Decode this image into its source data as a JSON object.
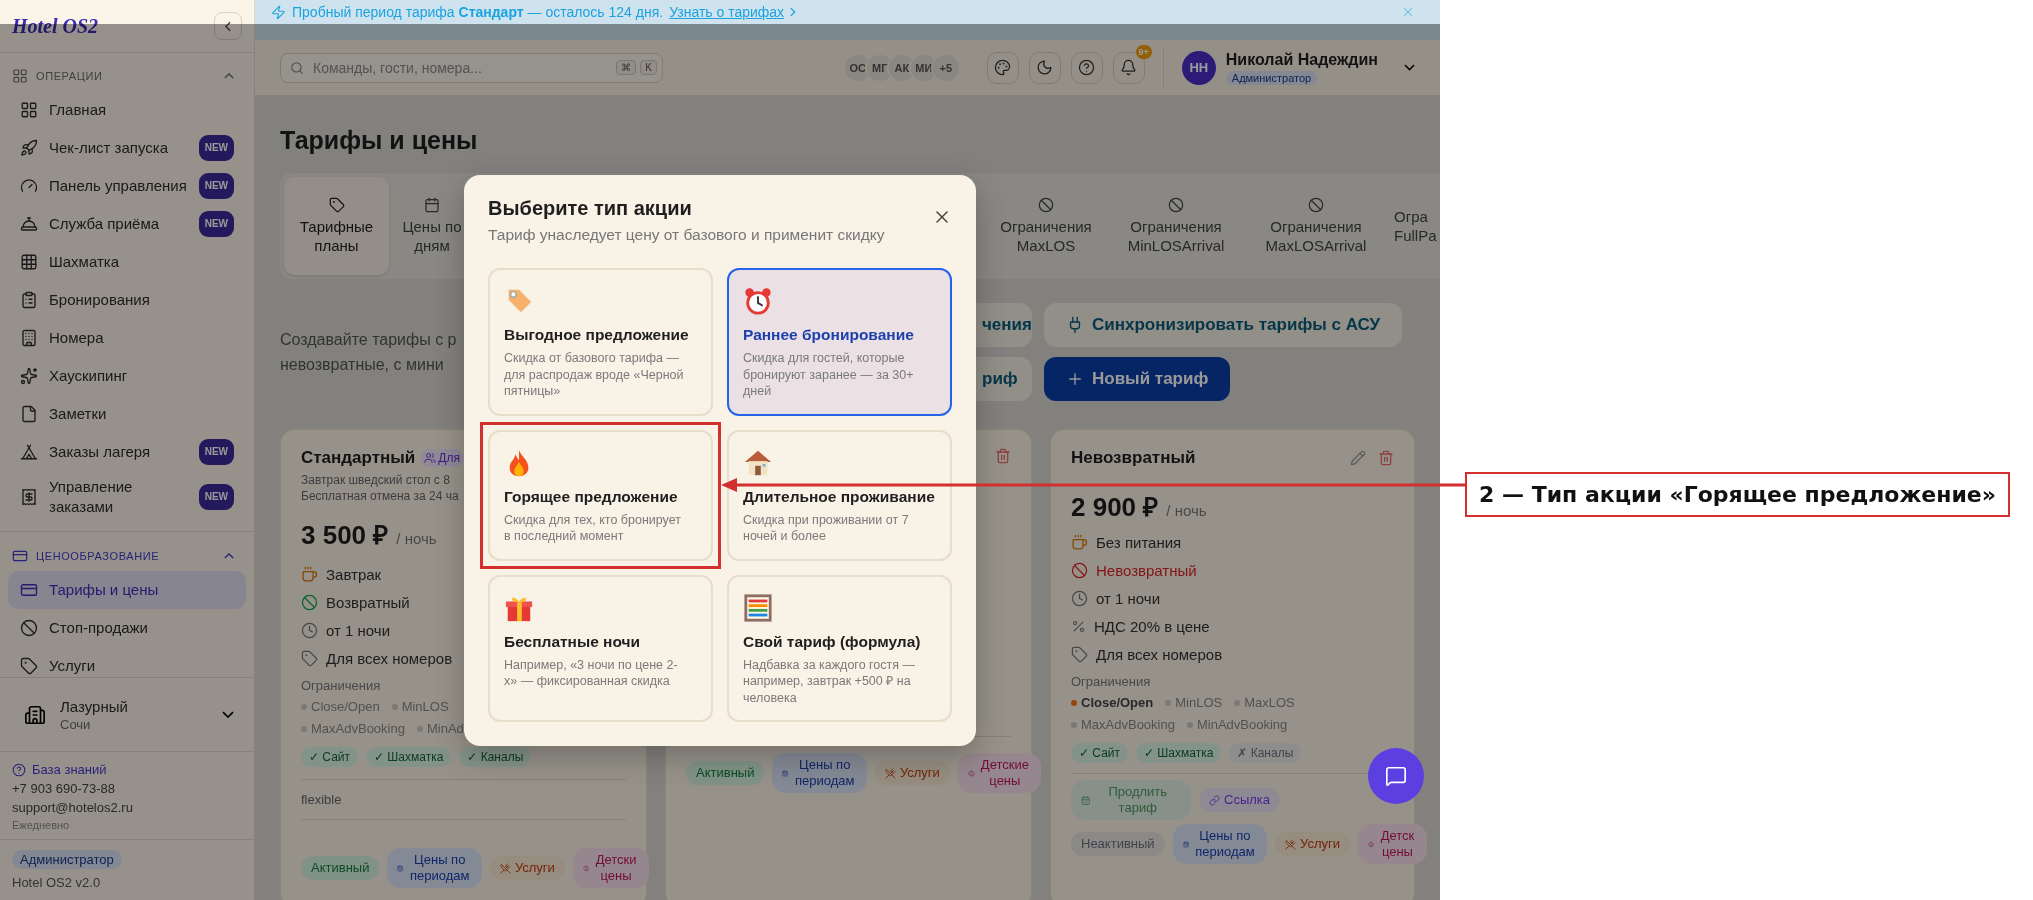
{
  "banner": {
    "text": "Пробный период тарифа **Стандарт** — осталось 124 дня.",
    "link": "Узнать о тарифах"
  },
  "sidebar": {
    "logo": "Hotel OS2",
    "sections": [
      {
        "title": "ОПЕРАЦИИ",
        "expanded": true,
        "items": [
          {
            "label": "Главная",
            "selected": false
          },
          {
            "label": "Чек-лист запуска",
            "badge": "NEW",
            "selected": false
          },
          {
            "label": "Панель управления",
            "badge": "NEW",
            "selected": false
          },
          {
            "label": "Служба приёма",
            "badge": "NEW",
            "selected": false
          },
          {
            "label": "Шахматка",
            "selected": false
          },
          {
            "label": "Бронирования",
            "selected": false
          },
          {
            "label": "Номера",
            "selected": false
          },
          {
            "label": "Хаускипинг",
            "selected": false
          },
          {
            "label": "Заметки",
            "selected": false
          },
          {
            "label": "Заказы лагеря",
            "badge": "NEW",
            "selected": false
          },
          {
            "label": "Управление заказами",
            "badge": "NEW",
            "selected": false
          }
        ]
      },
      {
        "title": "ЦЕНООБРАЗОВАНИЕ",
        "expanded": true,
        "items": [
          {
            "label": "Тарифы и цены",
            "selected": true
          },
          {
            "label": "Стоп-продажи",
            "selected": false
          },
          {
            "label": "Услуги",
            "selected": false
          }
        ]
      }
    ],
    "hotel": {
      "name": "Лазурный",
      "city": "Сочи"
    },
    "support": {
      "link": "База знаний",
      "phone": "+7 903 690-73-88",
      "email": "support@hotelos2.ru",
      "hours": "Ежедневно"
    },
    "footer": {
      "role": "Администратор",
      "version": "Hotel OS2 v2.0"
    }
  },
  "header": {
    "search": {
      "placeholder": "Команды, гости, номера...",
      "keys": [
        "⌘",
        "K"
      ]
    },
    "team": [
      "ОС",
      "МГ",
      "АК",
      "МИ",
      "+5"
    ],
    "notifications": "9+",
    "user": {
      "initials": "НН",
      "name": "Николай Надеждин",
      "role": "Администратор"
    }
  },
  "page": {
    "title": "Тарифы и цены",
    "tabs": [
      {
        "label": "Тарифные планы",
        "selected": true
      },
      {
        "label": "Цены по дням",
        "selected": false
      },
      {
        "label": "Ограничения MaxLOS",
        "selected": false
      },
      {
        "label": "Ограничения MinLOSArrival",
        "selected": false
      },
      {
        "label": "Ограничения MaxLOSArrival",
        "selected": false
      },
      {
        "label": "Огра FullPa",
        "selected": false
      }
    ],
    "description": [
      "Создавайте тарифы с р",
      "невозвратные, с мини"
    ],
    "actions": [
      [
        {
          "kind": "secondary",
          "label": "чения"
        },
        {
          "kind": "sync",
          "label": "Синхронизировать тарифы с АСУ"
        }
      ],
      [
        {
          "kind": "secondary",
          "label": "риф"
        },
        {
          "kind": "primary",
          "label": "Новый тариф"
        }
      ]
    ],
    "cards": [
      {
        "kind": "left",
        "name": "Стандартный",
        "badge": "Для",
        "description": [
          "Завтрак шведский стол с 8",
          "Бесплатная отмена за 24 ча"
        ],
        "price": "3 500 ₽",
        "unit": "/ ночь",
        "features": [
          {
            "kind": "meal",
            "text": "Завтрак"
          },
          {
            "kind": "refund",
            "text": "Возвратный",
            "refundable": true
          },
          {
            "kind": "nights",
            "text": "от 1 ночи"
          },
          {
            "kind": "rooms",
            "text": "Для всех номеров"
          }
        ],
        "restrictions_label": "Ограничения",
        "restrictions": [
          {
            "label": "Close/Open",
            "active": false
          },
          {
            "label": "MinLOS",
            "active": false
          },
          {
            "label": "MaxAdvBooking",
            "active": false
          },
          {
            "label": "MinAd",
            "active": false
          }
        ],
        "channels": [
          {
            "label": "✓ Сайт",
            "on": true
          },
          {
            "label": "✓ Шахматка",
            "on": true
          },
          {
            "label": "✓ Каналы",
            "on": true
          }
        ],
        "note": "flexible",
        "tags": [
          {
            "kind": "status",
            "label": "Активный",
            "on": true
          },
          {
            "kind": "periods",
            "label": "Цены по периодам"
          },
          {
            "kind": "services",
            "label": "Услуги"
          },
          {
            "kind": "kids",
            "label": "Детски цены"
          }
        ]
      },
      {
        "kind": "covered",
        "tags": [
          {
            "kind": "status",
            "label": "Активный",
            "on": true
          },
          {
            "kind": "periods",
            "label": "Цены по периодам"
          },
          {
            "kind": "services",
            "label": "Услуги"
          },
          {
            "kind": "kids",
            "label": "Детские цены"
          }
        ]
      },
      {
        "kind": "full",
        "name": "Невозвратный",
        "price": "2 900 ₽",
        "unit": "/ ночь",
        "features": [
          {
            "kind": "meal",
            "text": "Без питания"
          },
          {
            "kind": "refund",
            "text": "Невозвратный",
            "refundable": false
          },
          {
            "kind": "nights",
            "text": "от 1 ночи"
          },
          {
            "kind": "vat",
            "text": "НДС 20% в цене"
          },
          {
            "kind": "rooms",
            "text": "Для всех номеров"
          }
        ],
        "restrictions_label": "Ограничения",
        "restrictions": [
          {
            "label": "Close/Open",
            "active": true
          },
          {
            "label": "MinLOS",
            "active": false
          },
          {
            "label": "MaxLOS",
            "active": false
          },
          {
            "label": "MaxAdvBooking",
            "active": false
          },
          {
            "label": "MinAdvBooking",
            "active": false
          }
        ],
        "channels": [
          {
            "label": "✓ Сайт",
            "on": true
          },
          {
            "label": "✓ Шахматка",
            "on": true
          },
          {
            "label": "✗ Каналы",
            "on": false
          }
        ],
        "links": [
          {
            "kind": "extend",
            "label": "Продлить тариф"
          },
          {
            "kind": "link",
            "label": "Ссылка"
          }
        ],
        "tags": [
          {
            "kind": "status",
            "label": "Неактивный",
            "on": false
          },
          {
            "kind": "periods",
            "label": "Цены по периодам"
          },
          {
            "kind": "services",
            "label": "Услуги"
          },
          {
            "kind": "kids",
            "label": "Детск цены"
          }
        ]
      }
    ]
  },
  "modal": {
    "title": "Выберите тип акции",
    "subtitle": "Тариф унаследует цену от базового и применит скидку",
    "options": [
      {
        "title": "Выгодное предложение",
        "description": "Скидка от базового тарифа — для распродаж вроде «Черной пятницы»",
        "selected": false,
        "highlighted": false
      },
      {
        "title": "Раннее бронирование",
        "description": "Скидка для гостей, которые бронируют заранее — за 30+ дней",
        "selected": true,
        "highlighted": false
      },
      {
        "title": "Горящее предложение",
        "description": "Скидка для тех, кто бронирует в последний момент",
        "selected": false,
        "highlighted": true
      },
      {
        "title": "Длительное проживание",
        "description": "Скидка при проживании от 7 ночей и более",
        "selected": false,
        "highlighted": false
      },
      {
        "title": "Бесплатные ночи",
        "description": "Например, «3 ночи по цене 2-х» — фиксированная скидка",
        "selected": false,
        "highlighted": false
      },
      {
        "title": "Свой тариф (формула)",
        "description": "Надбавка за каждого гостя — например, завтрак +500 ₽ на человека",
        "selected": false,
        "highlighted": false
      }
    ]
  },
  "annotation": {
    "text": "2 — Тип акции «Горящее предложение»"
  }
}
